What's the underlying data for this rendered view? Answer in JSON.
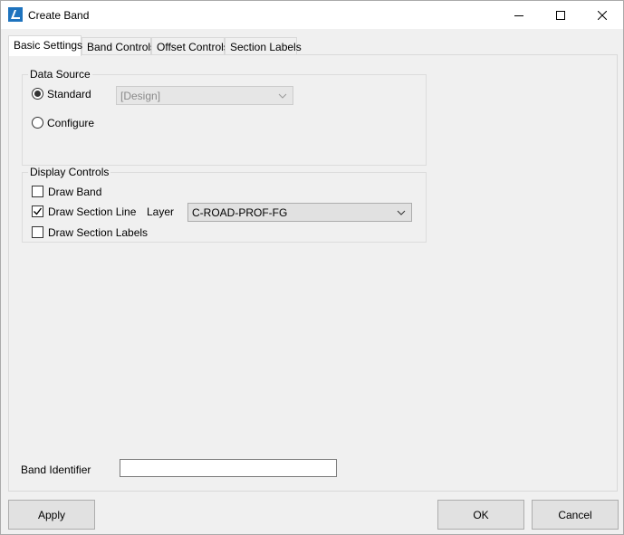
{
  "window": {
    "title": "Create Band"
  },
  "tabs": [
    {
      "label": "Basic Settings",
      "active": true
    },
    {
      "label": "Band Controls",
      "active": false
    },
    {
      "label": "Offset Controls",
      "active": false
    },
    {
      "label": "Section Labels",
      "active": false
    }
  ],
  "data_source": {
    "legend": "Data Source",
    "standard_label": "Standard",
    "standard_selected": true,
    "standard_combo_value": "[Design]",
    "configure_label": "Configure",
    "configure_selected": false
  },
  "display_controls": {
    "legend": "Display Controls",
    "draw_band_label": "Draw Band",
    "draw_band_checked": false,
    "draw_section_line_label": "Draw Section Line",
    "draw_section_line_checked": true,
    "layer_label": "Layer",
    "layer_value": "C-ROAD-PROF-FG",
    "draw_section_labels_label": "Draw Section Labels",
    "draw_section_labels_checked": false
  },
  "band_identifier": {
    "label": "Band Identifier",
    "value": ""
  },
  "buttons": {
    "apply": "Apply",
    "ok": "OK",
    "cancel": "Cancel"
  },
  "colors": {
    "accent": "#1e73be",
    "background": "#f0f0f0"
  }
}
